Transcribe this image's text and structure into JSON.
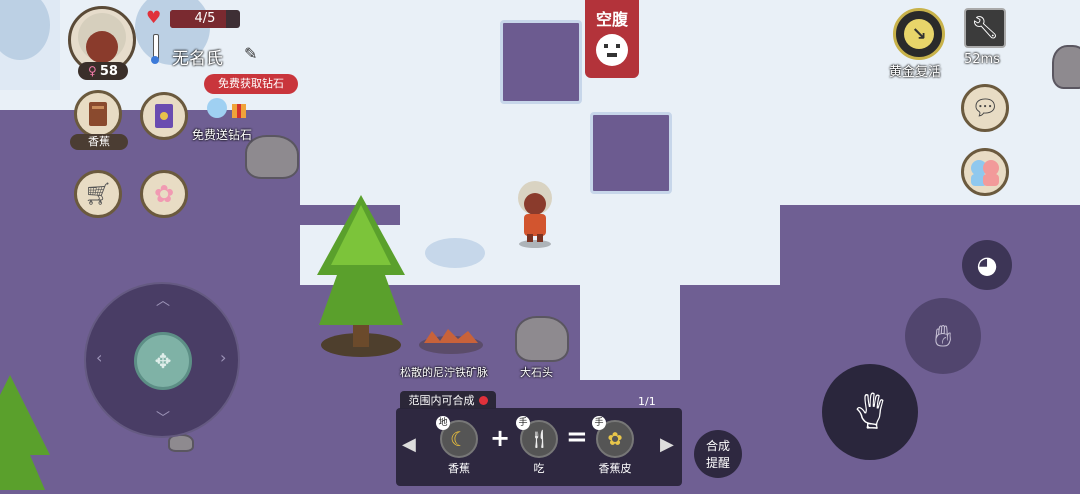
{
  "player": {
    "health": "4/5",
    "level": "58",
    "name": "无名氏"
  },
  "left_menu": {
    "banana_label": "香蕉",
    "free_diamond_badge": "免费获取钻石",
    "free_gift_label": "免费送钻石"
  },
  "status": {
    "hunger": "空腹"
  },
  "top_right": {
    "revive_label": "黄金复活",
    "ping": "52ms"
  },
  "world_labels": {
    "iron_vein": "松散的尼泞铁矿脉",
    "big_rock": "大石头"
  },
  "craft_bar": {
    "header": "范围内可合成",
    "page": "1/1",
    "item1_tag": "地",
    "item1_label": "香蕉",
    "plus": "+",
    "item2_tag": "手",
    "item2_label": "吃",
    "equals": "=",
    "item3_tag": "手",
    "item3_label": "香蕉皮"
  },
  "craft_remind": {
    "line1": "合成",
    "line2": "提醒"
  },
  "colors": {
    "ground": "#6f5f93",
    "snow": "#e9f0f7",
    "hunger_red": "#b3333a",
    "badge_red": "#c9353c"
  }
}
